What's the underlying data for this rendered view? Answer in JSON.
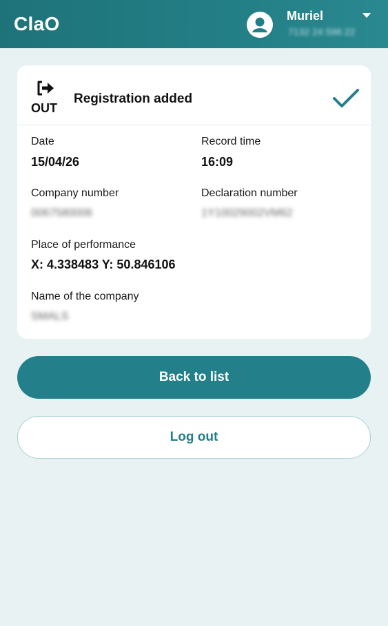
{
  "header": {
    "app_title": "ClaO",
    "user_name": "Muriel",
    "user_sub": "7132 24 596 22",
    "avatar_icon": "user-circle-icon",
    "dropdown_icon": "caret-down-icon"
  },
  "card": {
    "direction_icon": "sign-out-icon",
    "direction_label": "OUT",
    "title": "Registration added",
    "status_icon": "checkmark-icon",
    "fields": {
      "date": {
        "label": "Date",
        "value": "15/04/26"
      },
      "record_time": {
        "label": "Record time",
        "value": "16:09"
      },
      "company_number": {
        "label": "Company number",
        "value": "0067580006"
      },
      "declaration_number": {
        "label": "Declaration number",
        "value": "1Y10029002VM62"
      },
      "place": {
        "label": "Place of performance",
        "value": "X: 4.338483 Y: 50.846106"
      },
      "company_name": {
        "label": "Name of the company",
        "value": "SMALS"
      }
    }
  },
  "buttons": {
    "back_label": "Back to list",
    "logout_label": "Log out"
  },
  "colors": {
    "brand": "#237f89",
    "background": "#e9f2f3"
  }
}
